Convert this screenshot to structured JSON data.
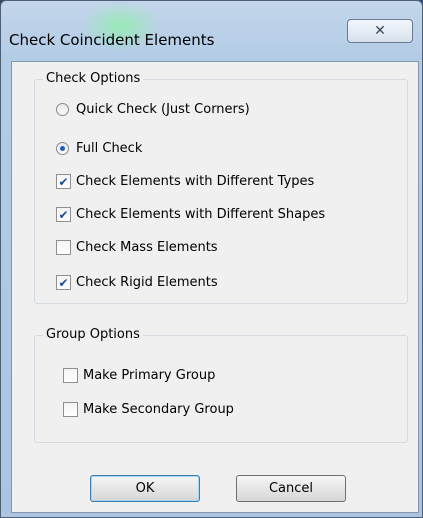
{
  "window": {
    "title": "Check Coincident Elements",
    "close_icon": "close-x-icon"
  },
  "check_options": {
    "label": "Check Options",
    "radios": [
      {
        "label": "Quick Check (Just Corners)",
        "selected": false
      },
      {
        "label": "Full Check",
        "selected": true
      }
    ],
    "checkboxes": [
      {
        "label": "Check Elements with Different Types",
        "checked": true
      },
      {
        "label": "Check Elements with Different Shapes",
        "checked": true
      },
      {
        "label": "Check Mass Elements",
        "checked": false
      },
      {
        "label": "Check Rigid Elements",
        "checked": true
      }
    ]
  },
  "group_options": {
    "label": "Group Options",
    "checkboxes": [
      {
        "label": "Make Primary Group",
        "checked": false
      },
      {
        "label": "Make Secondary Group",
        "checked": false
      }
    ]
  },
  "buttons": {
    "ok": "OK",
    "cancel": "Cancel"
  },
  "colors": {
    "accent": "#1e5fb3",
    "window_frame": "#b3cce6",
    "client_bg": "#f0f0f0"
  }
}
